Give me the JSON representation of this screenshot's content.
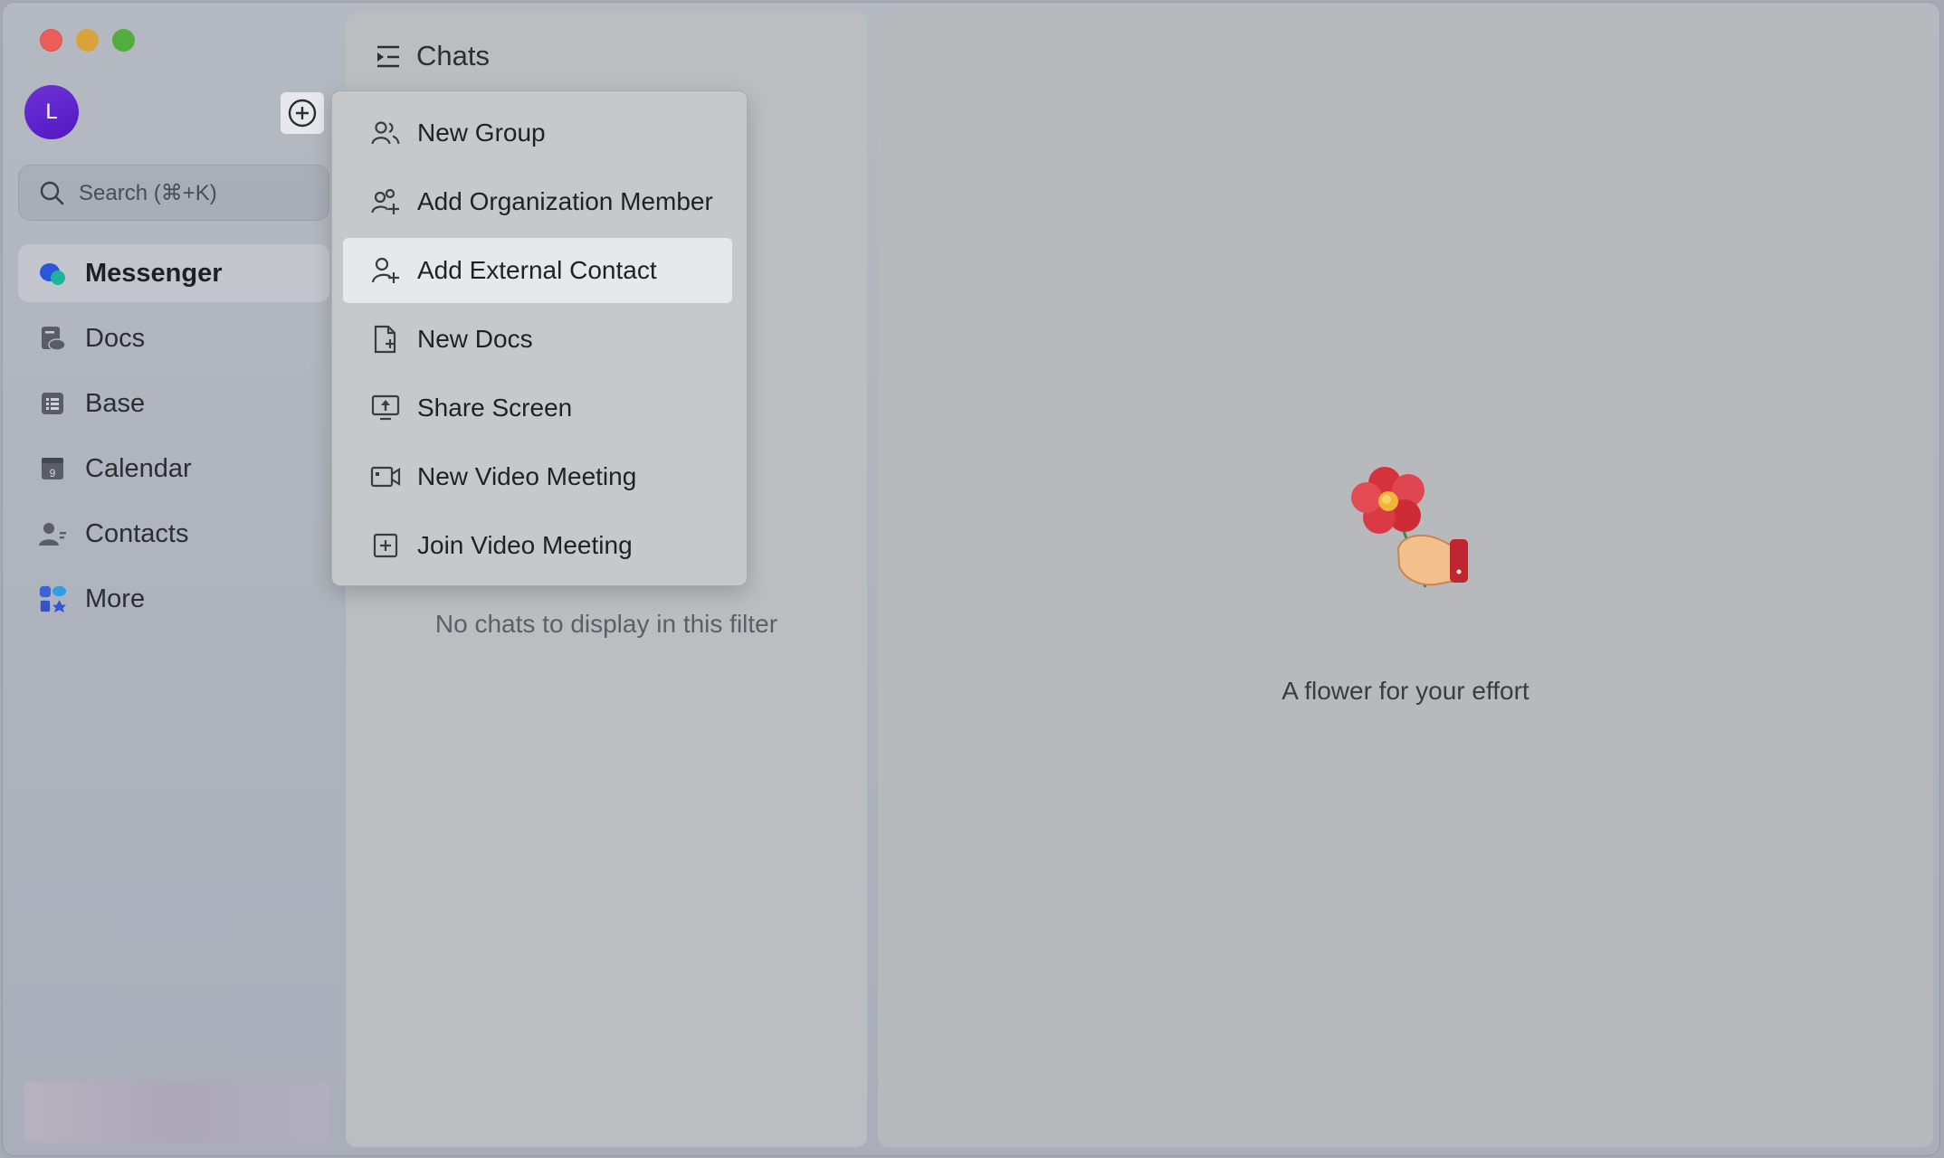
{
  "window": {
    "controls": [
      "close",
      "minimize",
      "maximize"
    ]
  },
  "profile": {
    "initial": "L"
  },
  "search": {
    "placeholder": "Search (⌘+K)"
  },
  "sidebar": {
    "items": [
      {
        "label": "Messenger",
        "icon": "messenger-icon",
        "active": true
      },
      {
        "label": "Docs",
        "icon": "docs-icon"
      },
      {
        "label": "Base",
        "icon": "base-icon"
      },
      {
        "label": "Calendar",
        "icon": "calendar-icon",
        "badge": "9"
      },
      {
        "label": "Contacts",
        "icon": "contacts-icon"
      },
      {
        "label": "More",
        "icon": "more-apps-icon"
      }
    ]
  },
  "chats": {
    "title": "Chats",
    "empty_message": "No chats to display in this filter"
  },
  "menu": {
    "items": [
      {
        "label": "New Group",
        "icon": "group-icon"
      },
      {
        "label": "Add Organization Member",
        "icon": "add-org-member-icon"
      },
      {
        "label": "Add External Contact",
        "icon": "add-contact-icon",
        "highlighted": true
      },
      {
        "label": "New Docs",
        "icon": "new-doc-icon"
      },
      {
        "label": "Share Screen",
        "icon": "share-screen-icon"
      },
      {
        "label": "New Video Meeting",
        "icon": "video-camera-icon"
      },
      {
        "label": "Join Video Meeting",
        "icon": "join-meeting-icon"
      }
    ]
  },
  "detail": {
    "caption": "A flower for your effort"
  },
  "colors": {
    "avatar": "#5a1fcf",
    "close": "#ec5c58",
    "minimize": "#d8a43a",
    "maximize": "#4fae3f",
    "accent": "#2b6be6"
  }
}
